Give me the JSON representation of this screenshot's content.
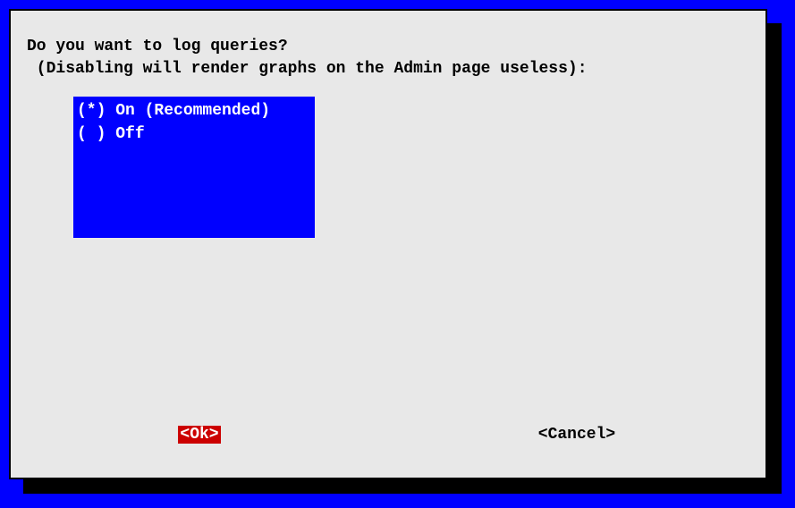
{
  "dialog": {
    "prompt_line1": "Do you want to log queries?",
    "prompt_line2": " (Disabling will render graphs on the Admin page useless):",
    "options": [
      {
        "marker": "(*)",
        "label": "On (Recommended)"
      },
      {
        "marker": "( )",
        "label": "Off"
      }
    ],
    "buttons": {
      "ok": "<Ok>",
      "cancel": "<Cancel>"
    }
  }
}
